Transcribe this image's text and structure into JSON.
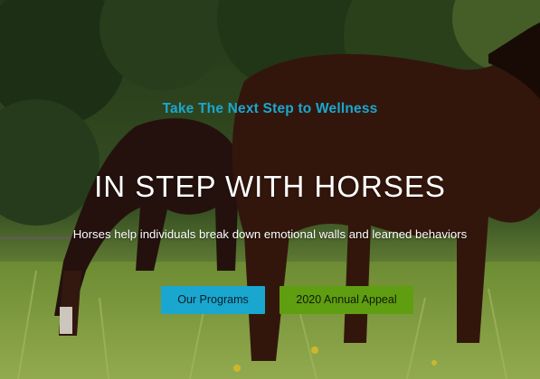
{
  "hero": {
    "tagline": "Take The Next Step to Wellness",
    "title": "IN STEP WITH HORSES",
    "subtitle": "Horses help individuals break down emotional walls and learned behaviors",
    "buttons": {
      "programs": "Our Programs",
      "appeal": "2020 Annual Appeal"
    }
  },
  "colors": {
    "accent_blue": "#1aa7cf",
    "accent_green": "#5f9e10",
    "title_text": "#ffffff"
  }
}
